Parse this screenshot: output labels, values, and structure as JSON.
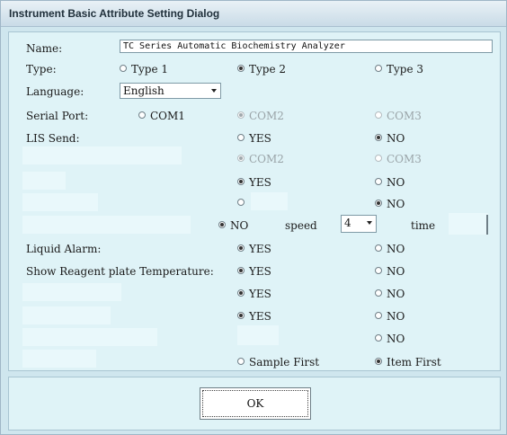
{
  "window": {
    "title": "Instrument Basic Attribute Setting Dialog"
  },
  "labels": {
    "name": "Name:",
    "type": "Type:",
    "language": "Language:",
    "serial_port": "Serial Port:",
    "lis_send": "LIS Send:",
    "liquid_alarm": "Liquid Alarm:",
    "show_reagent_temp": "Show Reagent plate Temperature:",
    "speed": "speed",
    "time": "time"
  },
  "name_value": "TC Series Automatic Biochemistry Analyzer",
  "type_options": [
    "Type 1",
    "Type 2",
    "Type 3"
  ],
  "type_selected": "Type 2",
  "language_value": "English",
  "serial_options": [
    "COM1",
    "COM2",
    "COM3"
  ],
  "lis_options": [
    "YES",
    "NO"
  ],
  "com_row2": [
    "COM2",
    "COM3"
  ],
  "row_yes_no": [
    "YES",
    "NO"
  ],
  "row_no": "NO",
  "speed_value": "4",
  "liquid_alarm_options": [
    "YES",
    "NO"
  ],
  "reagent_temp_options": [
    "YES",
    "NO"
  ],
  "row_yes_no_2": [
    "YES",
    "NO"
  ],
  "row_yes_no_3": [
    "YES",
    "NO"
  ],
  "row_no_2": "NO",
  "order_options": [
    "Sample First",
    "Item First"
  ],
  "ok_label": "OK"
}
